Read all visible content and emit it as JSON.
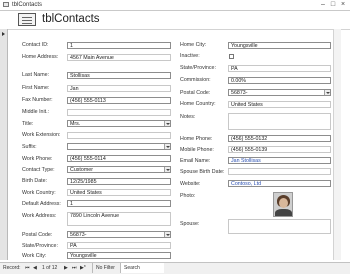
{
  "window": {
    "tab_title": "tblContacts",
    "minimize": "–",
    "maximize": "□",
    "close": "×"
  },
  "form": {
    "title": "tblContacts"
  },
  "left": {
    "contact_id": {
      "label": "Contact ID:",
      "value": "1"
    },
    "home_address": {
      "label": "Home Address:",
      "value": "4567 Main Avenue"
    },
    "last_name": {
      "label": "Last Name:",
      "value": "Stollisas"
    },
    "first_name": {
      "label": "First Name:",
      "value": "Jan"
    },
    "fax_number": {
      "label": "Fax Number:",
      "value": "(456) 555-0113"
    },
    "middle_init": {
      "label": "Middle Init.:",
      "value": ""
    },
    "title": {
      "label": "Title:",
      "value": "Mrs."
    },
    "work_extension": {
      "label": "Work Extension:",
      "value": ""
    },
    "suffix": {
      "label": "Suffix:",
      "value": ""
    },
    "work_phone": {
      "label": "Work Phone:",
      "value": "(456) 555-0114"
    },
    "contact_type": {
      "label": "Contact Type:",
      "value": "Customer"
    },
    "birth_date": {
      "label": "Birth Date:",
      "value": "12/25/1985"
    },
    "work_country": {
      "label": "Work Country:",
      "value": "United States"
    },
    "default_address": {
      "label": "Default Address:",
      "value": "1"
    },
    "work_address": {
      "label": "Work Address:",
      "value": "7890 Lincoln Avenue"
    },
    "postal_code": {
      "label": "Postal Code:",
      "value": "56873-"
    },
    "state_province": {
      "label": "State/Province:",
      "value": "PA"
    },
    "work_city": {
      "label": "Work City:",
      "value": "Youngsville"
    }
  },
  "right": {
    "home_city": {
      "label": "Home City:",
      "value": "Youngsville"
    },
    "inactive": {
      "label": "Inactive:"
    },
    "state_province": {
      "label": "State/Province:",
      "value": "PA"
    },
    "commission": {
      "label": "Commission:",
      "value": "0.00%"
    },
    "postal_code": {
      "label": "Postal Code:",
      "value": "56873-"
    },
    "home_country": {
      "label": "Home Country:",
      "value": "United States"
    },
    "notes": {
      "label": "Notes:",
      "value": ""
    },
    "home_phone": {
      "label": "Home Phone:",
      "value": "(456) 555-0132"
    },
    "mobile_phone": {
      "label": "Mobile Phone:",
      "value": "(456) 555-0139"
    },
    "email_name": {
      "label": "Email Name:",
      "value": "Jan Stollisas"
    },
    "spouse_birth_date": {
      "label": "Spouse Birth Date:",
      "value": ""
    },
    "website": {
      "label": "Website:",
      "value": "Contoso, Ltd"
    },
    "photo": {
      "label": "Photo:"
    },
    "spouse": {
      "label": "Spouse:",
      "value": ""
    }
  },
  "navbar": {
    "record_label": "Record:",
    "first": "⏮",
    "prev": "◀",
    "position": "1 of 12",
    "next": "▶",
    "last": "⏭",
    "new": "▶*",
    "filter": "No Filter",
    "search": "Search"
  }
}
